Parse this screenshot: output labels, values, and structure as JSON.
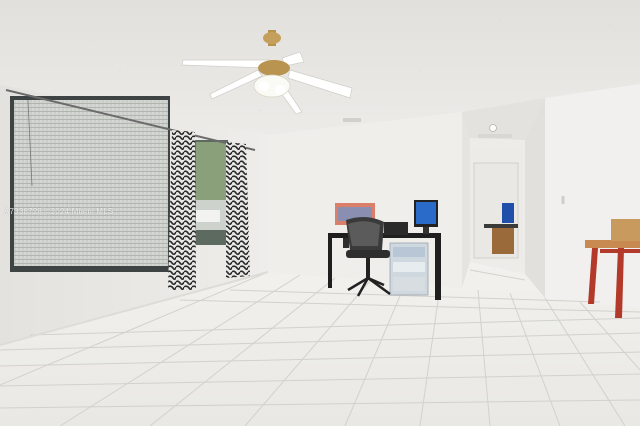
{
  "watermark": {
    "text": "A7338728 ©2024 Miami MLS"
  },
  "palette": {
    "ceiling": "#e7e5e2",
    "wall": "#eeece9",
    "floor_tile": "#efeeeb",
    "grout": "#cfcdc8",
    "curtain_pattern": "#2b2b2b",
    "desk": "#1f1f1f",
    "side_table_legs": "#b33a2a",
    "side_table_top": "#c98a52",
    "fan_blades": "#ffffff",
    "fan_brass": "#b89450"
  },
  "objects": {
    "ceiling_fan": "ceiling-fan",
    "window": "window-with-blinds",
    "curtains": "patterned-curtains",
    "desk": "computer-desk",
    "monitor": "computer-monitor",
    "chair": "office-chair",
    "storage": "plastic-drawer-organizer",
    "hallway": "hallway",
    "side_table": "side-table"
  }
}
